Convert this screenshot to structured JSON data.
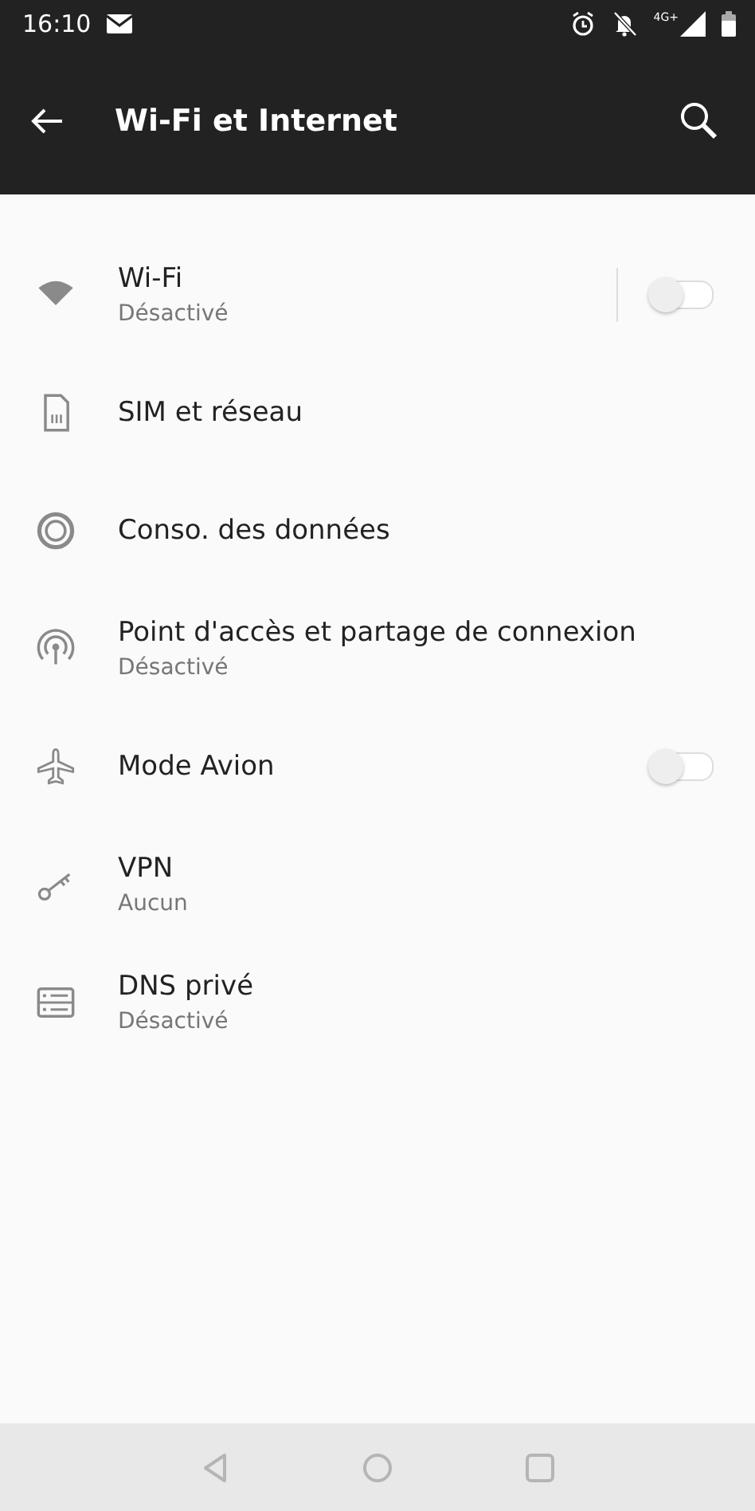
{
  "status_bar": {
    "time": "16:10",
    "network": "4G+"
  },
  "app_bar": {
    "title": "Wi-Fi et Internet"
  },
  "items": [
    {
      "kind": "toggle",
      "title": "Wi-Fi",
      "summary": "Désactivé",
      "on": false
    },
    {
      "kind": "link",
      "title": "SIM et réseau"
    },
    {
      "kind": "link",
      "title": "Conso. des données"
    },
    {
      "kind": "link",
      "title": "Point d'accès et partage de connexion",
      "summary": "Désactivé"
    },
    {
      "kind": "toggle",
      "title": "Mode Avion",
      "on": false
    },
    {
      "kind": "link",
      "title": "VPN",
      "summary": "Aucun"
    },
    {
      "kind": "link",
      "title": "DNS privé",
      "summary": "Désactivé"
    }
  ]
}
